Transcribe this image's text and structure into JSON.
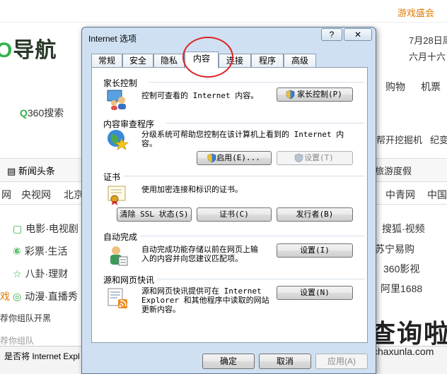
{
  "background": {
    "game_link": "游戏盛会",
    "logo_text": "导航",
    "date_line1": "7月28日周",
    "date_line2": "六月十六",
    "search_label": "360搜索",
    "news_label": "新闻头条",
    "right_links": [
      "购物",
      "机票",
      "帮开挖掘机",
      "纪变",
      "旅游度假",
      "中青网",
      "中国"
    ],
    "nav_links": [
      "网",
      "央视网",
      "北京"
    ],
    "side_items": [
      {
        "icon": "▢",
        "label": "电影·电视剧"
      },
      {
        "icon": "⑥",
        "label": "彩票·生活"
      },
      {
        "icon": "☆",
        "label": "八卦·理财"
      },
      {
        "icon": "◎",
        "label": "动漫·直播秀"
      }
    ],
    "right_items": [
      "搜狐·视频",
      "苏宁易购",
      "360影视",
      "阿里1688"
    ],
    "left_fragments": [
      "戏",
      "荐你组队开黑",
      "荐你组队"
    ],
    "banner_text": "是否将 Internet Expl",
    "brand_title": "查询啦",
    "brand_url": "chaxunla.com"
  },
  "dialog": {
    "title": "Internet 选项",
    "help": "?",
    "close": "✕",
    "tabs": [
      "常规",
      "安全",
      "隐私",
      "内容",
      "连接",
      "程序",
      "高级"
    ],
    "active_tab": "内容",
    "parental": {
      "heading": "家长控制",
      "text": "控制可查看的 Internet 内容。",
      "button": "家长控制(P)"
    },
    "advisor": {
      "heading": "内容审查程序",
      "text1": "分级系统可帮助您控制在该计算机上看到的 Internet 内",
      "text2": "容。",
      "enable": "启用(E)...",
      "settings": "设置(T)"
    },
    "certificates": {
      "heading": "证书",
      "text": "使用加密连接和标识的证书。",
      "clear_ssl": "清除 SSL 状态(S)",
      "certs": "证书(C)",
      "publishers": "发行者(B)"
    },
    "autocomplete": {
      "heading": "自动完成",
      "text1": "自动完成功能存储以前在网页上输",
      "text2": "入的内容并向您建议匹配项。",
      "settings": "设置(I)"
    },
    "feeds": {
      "heading": "源和网页快讯",
      "text1": "源和网页快讯提供可在 Internet",
      "text2": "Explorer 和其他程序中读取的网站",
      "text3": "更新内容。",
      "settings": "设置(N)"
    },
    "footer": {
      "ok": "确定",
      "cancel": "取消",
      "apply": "应用(A)"
    }
  }
}
